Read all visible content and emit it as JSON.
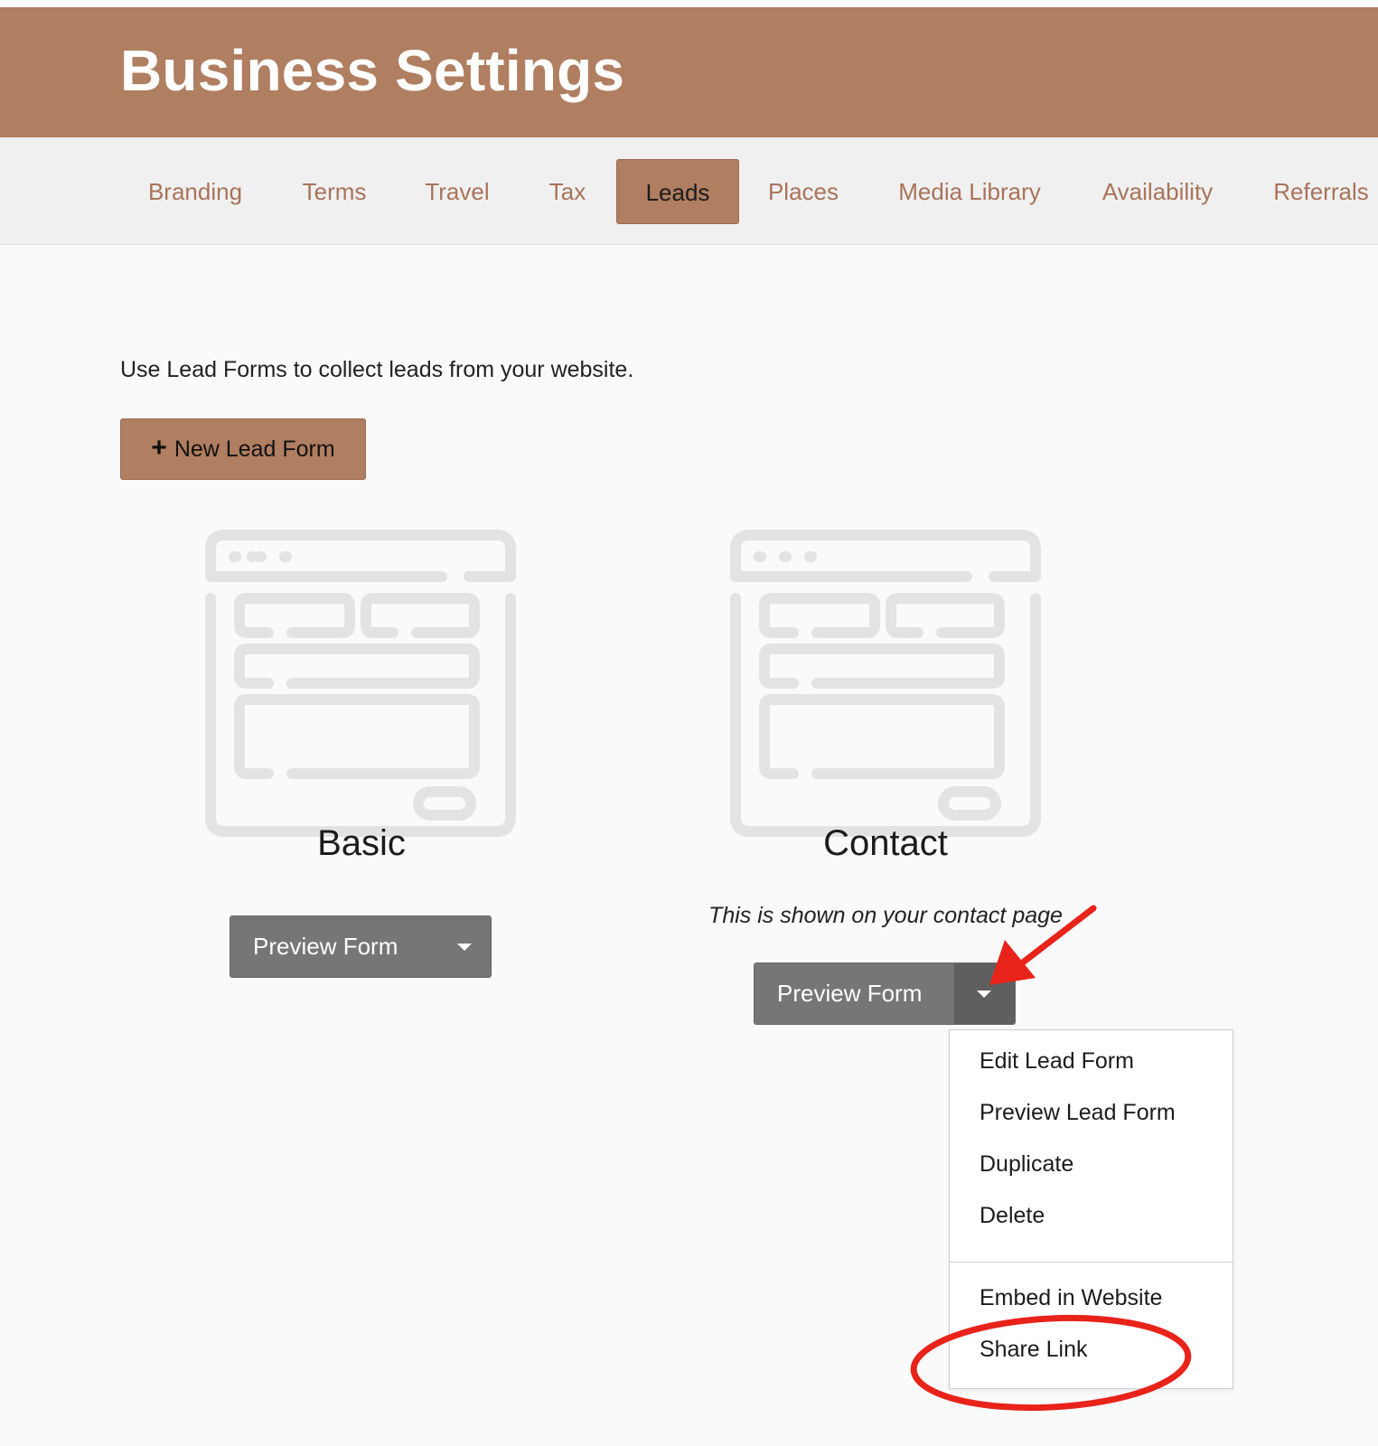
{
  "header": {
    "title": "Business Settings"
  },
  "tabs": [
    {
      "label": "Branding",
      "active": false
    },
    {
      "label": "Terms",
      "active": false
    },
    {
      "label": "Travel",
      "active": false
    },
    {
      "label": "Tax",
      "active": false
    },
    {
      "label": "Leads",
      "active": true
    },
    {
      "label": "Places",
      "active": false
    },
    {
      "label": "Media Library",
      "active": false
    },
    {
      "label": "Availability",
      "active": false
    },
    {
      "label": "Referrals",
      "active": false
    }
  ],
  "main": {
    "intro": "Use Lead Forms to collect leads from your website.",
    "new_button": {
      "icon": "plus-icon",
      "label": "New Lead Form"
    },
    "forms": [
      {
        "name": "Basic",
        "description": "",
        "button_label": "Preview Form",
        "icon": "form-template-icon"
      },
      {
        "name": "Contact",
        "description": "This is shown on your contact page",
        "button_label": "Preview Form",
        "icon": "form-template-icon",
        "menu_open": true
      }
    ]
  },
  "dropdown": {
    "group1": [
      "Edit Lead Form",
      "Preview Lead Form",
      "Duplicate",
      "Delete"
    ],
    "group2": [
      "Embed in Website",
      "Share Link"
    ]
  },
  "annotations": {
    "arrow_color": "#e8231a",
    "circle_color": "#e8231a",
    "circled_item": "Share Link"
  },
  "colors": {
    "brand": "#b07e60",
    "tab_text": "#a9735a",
    "button_gray": "#767676",
    "icon_gray": "#e3e3e3"
  }
}
